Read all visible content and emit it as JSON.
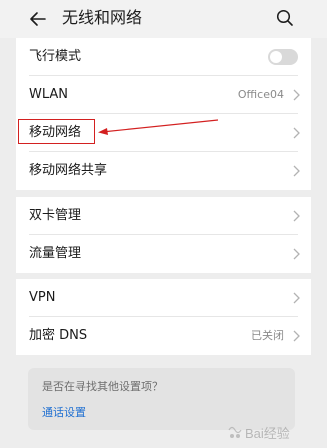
{
  "header": {
    "title": "无线和网络"
  },
  "section1": {
    "items": [
      {
        "label": "飞行模式",
        "control": "toggle",
        "toggle_on": false
      },
      {
        "label": "WLAN",
        "value": "Office04"
      },
      {
        "label": "移动网络"
      },
      {
        "label": "移动网络共享"
      }
    ]
  },
  "section2": {
    "items": [
      {
        "label": "双卡管理"
      },
      {
        "label": "流量管理"
      }
    ]
  },
  "section3": {
    "items": [
      {
        "label": "VPN"
      },
      {
        "label": "加密 DNS",
        "value": "已关闭"
      }
    ]
  },
  "suggestion": {
    "question": "是否在寻找其他设置项？",
    "link": "通话设置"
  },
  "annotation": {
    "highlight_color": "#d32020",
    "highlighted_item": "移动网络"
  },
  "watermark": {
    "text": "Bai经验"
  },
  "colors": {
    "background": "#ededed",
    "card": "#ffffff",
    "link": "#1f6fd1",
    "secondary_text": "#8a8a8a"
  }
}
